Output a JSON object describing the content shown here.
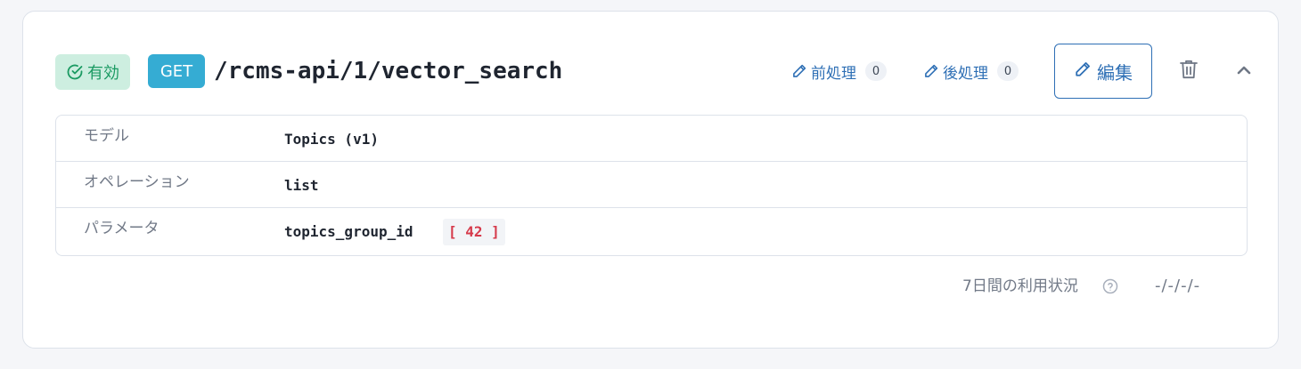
{
  "endpoint": {
    "status_label": "有効",
    "method": "GET",
    "path": "/rcms-api/1/vector_search"
  },
  "toolbar": {
    "preprocess_label": "前処理",
    "preprocess_count": "0",
    "postprocess_label": "後処理",
    "postprocess_count": "0",
    "edit_label": "編集"
  },
  "details": {
    "model_label": "モデル",
    "model_value": "Topics (v1)",
    "operation_label": "オペレーション",
    "operation_value": "list",
    "params_label": "パラメータ",
    "param_name": "topics_group_id",
    "param_value": "[ 42 ]"
  },
  "usage": {
    "label": "7日間の利用状況",
    "value": "-/-/-/-"
  },
  "colors": {
    "status_bg": "#cdeee0",
    "status_text": "#1a9a62",
    "method_bg": "#35acd3",
    "accent": "#2e6fb5",
    "param_value_text": "#d63a4b"
  },
  "icons": {
    "status": "check-circle-icon",
    "preprocess": "pencil-icon",
    "postprocess": "pencil-icon",
    "edit": "pencil-icon",
    "delete": "trash-icon",
    "collapse": "chevron-up-icon",
    "help": "question-circle-icon"
  }
}
